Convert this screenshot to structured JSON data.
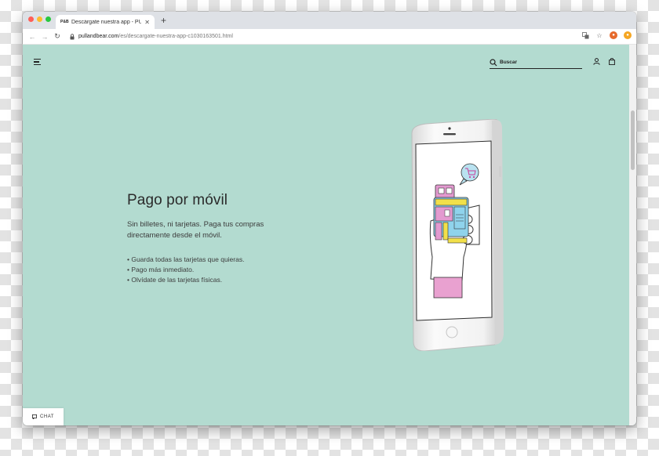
{
  "browser": {
    "tab": {
      "favicon_text": "PULL&BEAR",
      "title": "Descárgate nuestra app - PULL",
      "close_glyph": "✕"
    },
    "new_tab_glyph": "+",
    "address": {
      "domain": "pullandbear.com",
      "path": "/es/descargate-nuestra-app-c1030163501.html"
    },
    "nav": {
      "back": "←",
      "forward": "→",
      "reload": "↻"
    },
    "toolbar_icons": [
      "translate-icon",
      "bookmark-star-icon",
      "fox-extension-icon",
      "badge-extension-icon"
    ]
  },
  "site": {
    "search": {
      "placeholder": "Buscar"
    },
    "hero": {
      "title": "Pago por móvil",
      "subtitle": "Sin billetes, ni tarjetas. Paga tus compras directamente desde el móvil.",
      "features": [
        "Guarda todas las tarjetas que quieras.",
        "Pago más inmediato.",
        "Olvídate de las tarjetas físicas."
      ]
    },
    "chat": {
      "label": "CHAT"
    }
  },
  "colors": {
    "page_background": "#b3dbd0",
    "text": "#2a2a2a",
    "accent_pink": "#e39ad0",
    "accent_blue": "#8fd3ec",
    "accent_yellow": "#f2e04a"
  }
}
